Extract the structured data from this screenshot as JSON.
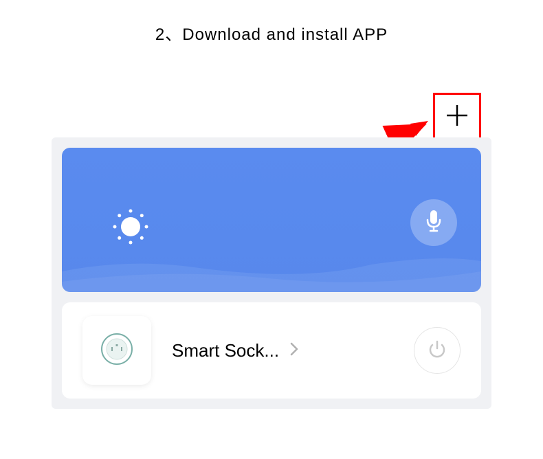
{
  "title": "2、Download and install APP",
  "device": {
    "name": "Smart Sock...",
    "icon": "socket-icon"
  },
  "annotations": {
    "plusButton": "add-icon",
    "arrow": "red-arrow"
  },
  "header": {
    "weatherIcon": "sun-icon",
    "micButton": "mic-icon"
  }
}
